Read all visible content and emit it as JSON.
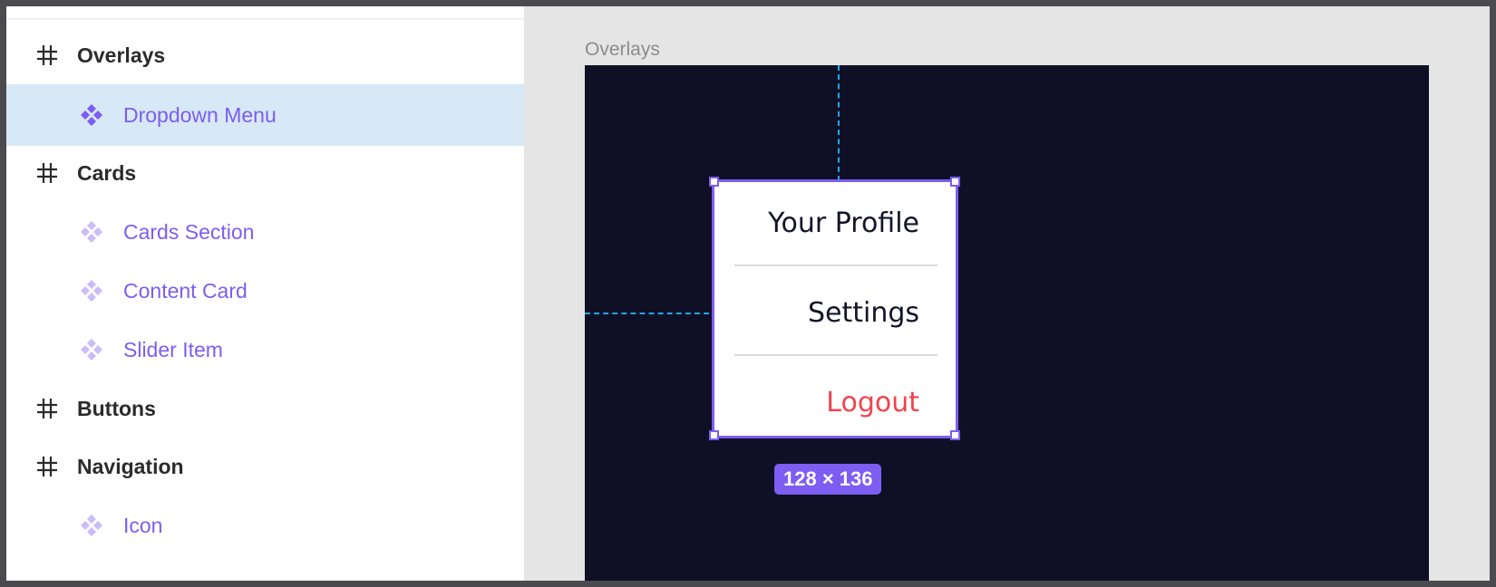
{
  "layers": {
    "items": [
      {
        "type": "frame",
        "label": "Overlays",
        "icon": "frame-hash-icon"
      },
      {
        "type": "component",
        "label": "Dropdown Menu",
        "icon": "component-icon",
        "selected": true
      },
      {
        "type": "frame",
        "label": "Cards",
        "icon": "frame-hash-icon"
      },
      {
        "type": "component",
        "label": "Cards Section",
        "icon": "component-icon"
      },
      {
        "type": "component",
        "label": "Content Card",
        "icon": "component-icon"
      },
      {
        "type": "component",
        "label": "Slider Item",
        "icon": "component-icon"
      },
      {
        "type": "frame",
        "label": "Buttons",
        "icon": "frame-hash-icon"
      },
      {
        "type": "frame",
        "label": "Navigation",
        "icon": "frame-hash-icon"
      },
      {
        "type": "component",
        "label": "Icon",
        "icon": "component-icon"
      }
    ]
  },
  "canvas": {
    "frame_title": "Overlays",
    "dropdown": {
      "items": [
        "Your Profile",
        "Settings",
        "Logout"
      ]
    },
    "size_badge": "128 × 136"
  },
  "colors": {
    "accent": "#7d5df2",
    "selected_row": "#d7e9f6",
    "artboard": "#0f1026",
    "guide": "#1fa6e8",
    "logout": "#f2434d"
  }
}
